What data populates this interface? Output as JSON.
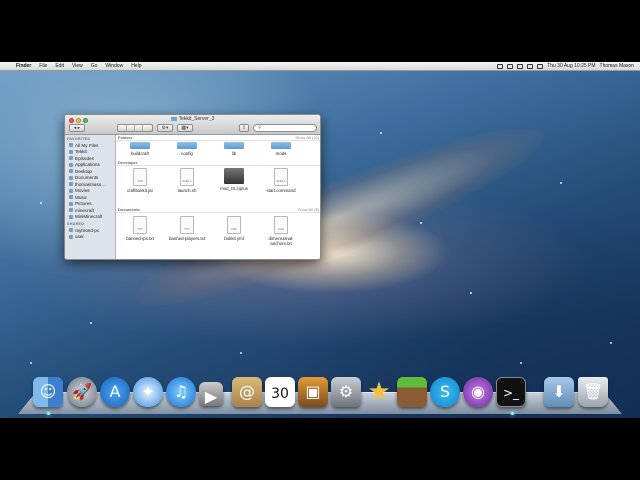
{
  "menubar": {
    "app": "Finder",
    "menus": [
      "File",
      "Edit",
      "View",
      "Go",
      "Window",
      "Help"
    ],
    "clock": "Thu 30 Aug  10:25 PM",
    "user": "Thomas Mason"
  },
  "window": {
    "title": "Tekkit_Server_3",
    "search_placeholder": ""
  },
  "sidebar": {
    "favorites_header": "FAVORITES",
    "favorites": [
      "All My Files",
      "Tekkit",
      "Episodes",
      "Applications",
      "Desktop",
      "Documents",
      "thomasmaso…",
      "Movies",
      "Music",
      "Pictures",
      "minecraft",
      "MiniMinecraft"
    ],
    "shared_header": "SHARED",
    "shared": [
      "raymond-pc",
      "user"
    ]
  },
  "groups": {
    "folders": {
      "name": "Folders",
      "show_all": "Show All (10)",
      "items": [
        "buildcraft",
        "config",
        "lib",
        "mods"
      ]
    },
    "developer": {
      "name": "Developer",
      "items": [
        "craftbukkit.jar",
        "launch.sh",
        "mod_IS.zip/us",
        "start.command"
      ],
      "exts": [
        "JAR",
        "SHELL",
        "",
        "SHELL"
      ]
    },
    "documents": {
      "name": "Documents",
      "show_all": "Show All (8)",
      "items": [
        "banned-ips.txt",
        "banned-players.txt",
        "bukkit.yml",
        "dimensional-anchors.txt"
      ],
      "exts": [
        "TXT",
        "TXT",
        "YML",
        "LOG"
      ]
    }
  },
  "dock": {
    "apps": [
      "Finder",
      "Launchpad",
      "App Store",
      "Safari",
      "iTunes",
      "FaceTime",
      "Contacts",
      "Calendar",
      "iPhoto",
      "System Preferences",
      "iMovie",
      "Minecraft",
      "Skype",
      "Podcast",
      "Terminal",
      "Downloads",
      "Trash"
    ],
    "calendar_date": "30"
  }
}
